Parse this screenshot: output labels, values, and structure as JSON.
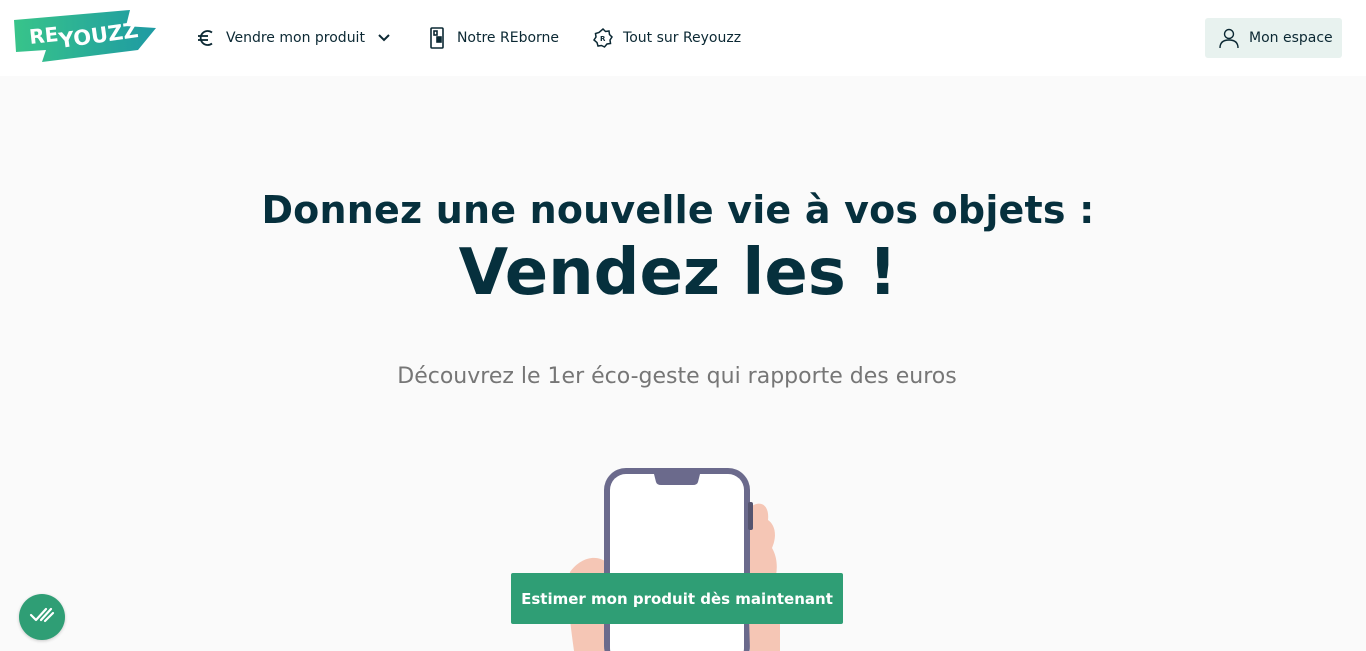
{
  "brand": {
    "logo_text_re": "RE",
    "logo_text_youzz": "YOUZZ",
    "colors": {
      "primary": "#2f9e75",
      "dark": "#06303d",
      "logo_gradient_start": "#38c48a",
      "logo_gradient_end": "#1e9aa3"
    }
  },
  "nav": {
    "items": [
      {
        "label": "Vendre mon produit",
        "icon": "euro-icon",
        "has_dropdown": true
      },
      {
        "label": "Notre REborne",
        "icon": "kiosk-icon",
        "has_dropdown": false
      },
      {
        "label": "Tout sur Reyouzz",
        "icon": "reyouzz-badge-icon",
        "has_dropdown": false
      }
    ],
    "account_label": "Mon espace",
    "account_icon": "user-icon"
  },
  "hero": {
    "line1": "Donnez une nouvelle vie à vos objets :",
    "line2": "Vendez les !",
    "subtitle": "Découvrez le 1er éco-geste qui rapporte des euros",
    "cta_label": "Estimer mon produit dès maintenant"
  },
  "floating": {
    "icon": "double-check-icon"
  }
}
